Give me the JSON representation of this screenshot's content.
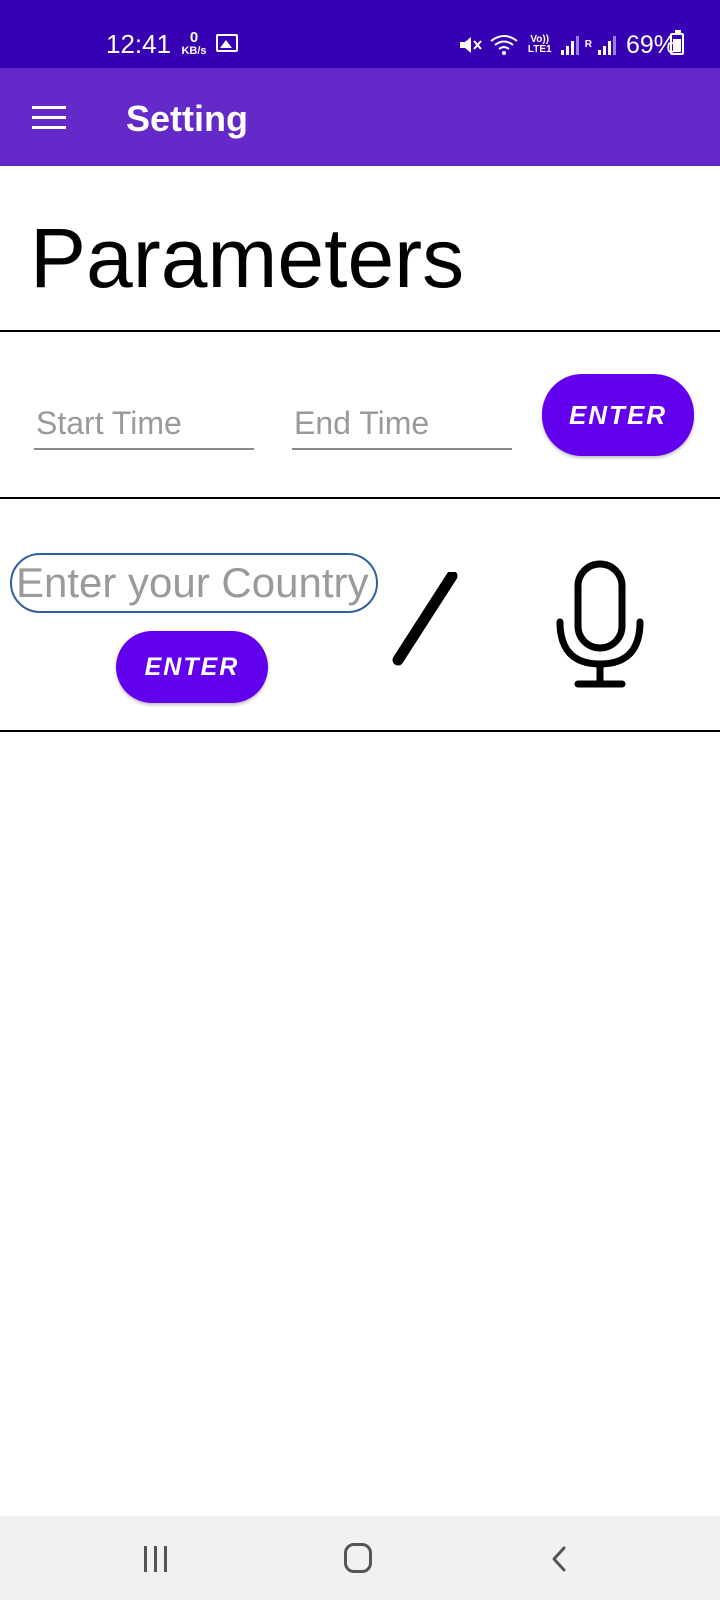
{
  "status_bar": {
    "time": "12:41",
    "kbs_value": "0",
    "kbs_unit": "KB/s",
    "lte_badge": "Vo)) LTE1",
    "roaming_badge": "R",
    "battery": "69%"
  },
  "app_bar": {
    "title": "Setting",
    "menu_icon": "menu-icon",
    "background": "#642ac9"
  },
  "main": {
    "heading": "Parameters",
    "start_time_placeholder": "Start Time",
    "end_time_placeholder": "End Time",
    "time_enter_label": "ENTER",
    "country_placeholder": "Enter your Country",
    "country_enter_label": "ENTER",
    "pen_icon": "pen-icon",
    "mic_icon": "microphone-icon"
  },
  "nav_bar": {
    "recent_icon": "recent-apps-icon",
    "home_icon": "home-icon",
    "back_icon": "back-icon"
  },
  "colors": {
    "status_bar": "#3700b3",
    "accent": "#6200ee"
  }
}
